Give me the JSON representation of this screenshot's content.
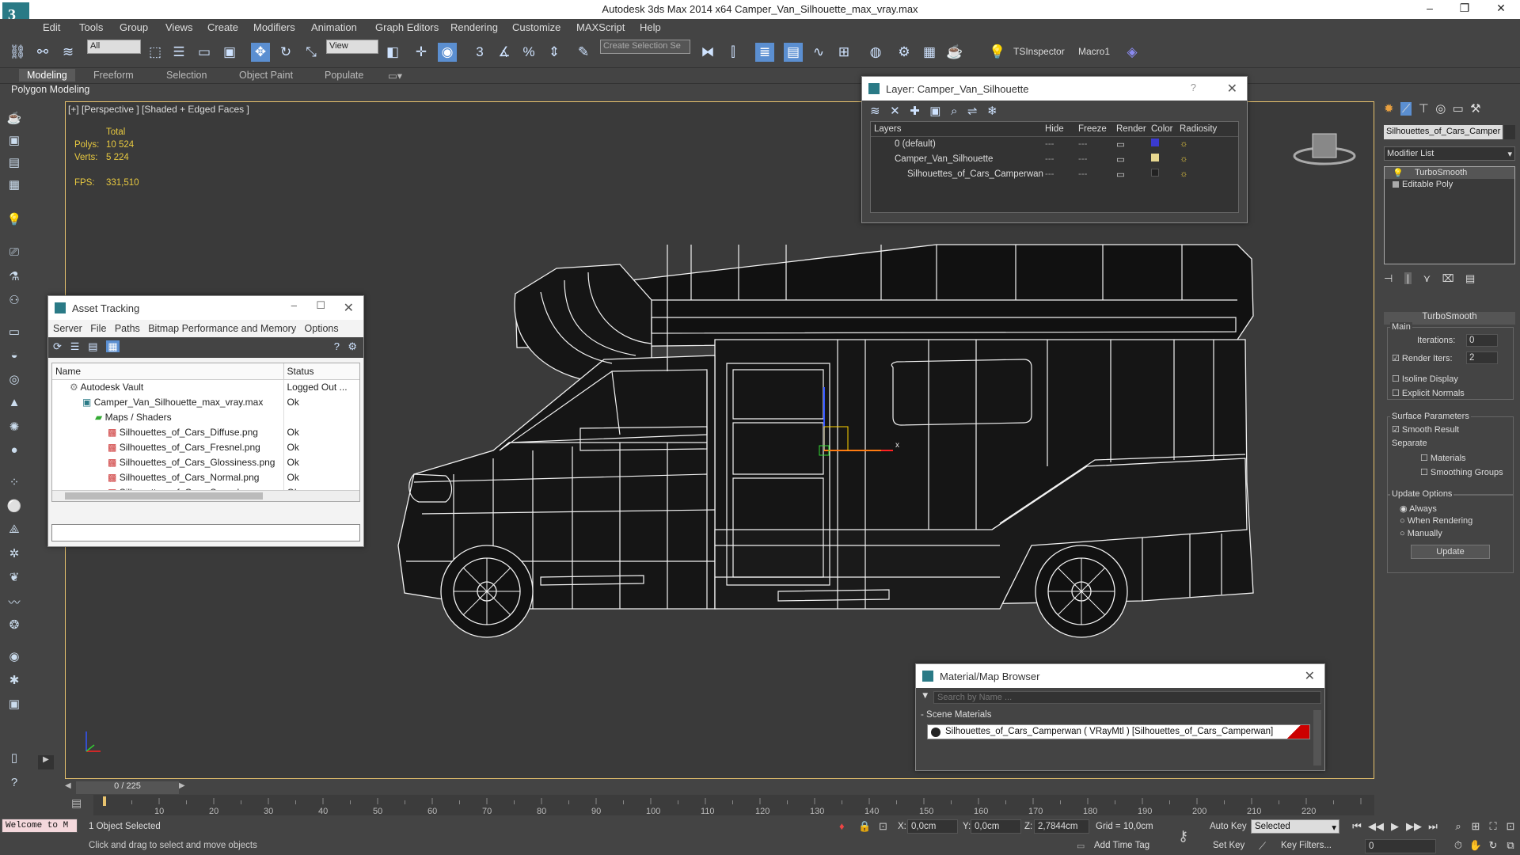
{
  "window": {
    "title": "Autodesk 3ds Max  2014 x64     Camper_Van_Silhouette_max_vray.max"
  },
  "menu": [
    "Edit",
    "Tools",
    "Group",
    "Views",
    "Create",
    "Modifiers",
    "Animation",
    "Graph Editors",
    "Rendering",
    "Customize",
    "MAXScript",
    "Help"
  ],
  "toolbar": {
    "filter": "All",
    "refcoord": "View",
    "selection_set": "Create Selection Se",
    "tsinspector": "TSInspector",
    "macro": "Macro1"
  },
  "ribbon": {
    "tabs": [
      "Modeling",
      "Freeform",
      "Selection",
      "Object Paint",
      "Populate"
    ],
    "sub": "Polygon Modeling"
  },
  "viewport": {
    "label": "[+] [Perspective ] [Shaded + Edged Faces ]",
    "stats": {
      "total": "Total",
      "polys_label": "Polys:",
      "polys": "10 524",
      "verts_label": "Verts:",
      "verts": "5 224",
      "fps_label": "FPS:",
      "fps": "331,510"
    },
    "gizmo_x": "x"
  },
  "layer_dialog": {
    "title": "Layer: Camper_Van_Silhouette",
    "help": "?",
    "columns": [
      "Layers",
      "Hide",
      "Freeze",
      "Render",
      "Color",
      "Radiosity"
    ],
    "rows": [
      {
        "name": "0 (default)",
        "color": "#3a3ad0"
      },
      {
        "name": "Camper_Van_Silhouette",
        "color": "#e8d890"
      },
      {
        "name": "Silhouettes_of_Cars_Camperwan",
        "color": "#222222"
      }
    ]
  },
  "asset_tracking": {
    "title": "Asset Tracking",
    "menu": [
      "Server",
      "File",
      "Paths",
      "Bitmap Performance and Memory",
      "Options"
    ],
    "columns": [
      "Name",
      "Status"
    ],
    "rows": [
      {
        "name": "Autodesk Vault",
        "status": "Logged Out ..."
      },
      {
        "name": "Camper_Van_Silhouette_max_vray.max",
        "status": "Ok"
      },
      {
        "name": "Maps / Shaders",
        "status": ""
      },
      {
        "name": "Silhouettes_of_Cars_Diffuse.png",
        "status": "Ok"
      },
      {
        "name": "Silhouettes_of_Cars_Fresnel.png",
        "status": "Ok"
      },
      {
        "name": "Silhouettes_of_Cars_Glossiness.png",
        "status": "Ok"
      },
      {
        "name": "Silhouettes_of_Cars_Normal.png",
        "status": "Ok"
      },
      {
        "name": "Silhouettes_of_Cars_Specular.png",
        "status": "Ok"
      }
    ]
  },
  "material_browser": {
    "title": "Material/Map Browser",
    "search_placeholder": "Search by Name ...",
    "section": "- Scene Materials",
    "item": "Silhouettes_of_Cars_Camperwan ( VRayMtl ) [Silhouettes_of_Cars_Camperwan]"
  },
  "command_panel": {
    "object_name": "Silhouettes_of_Cars_Camper",
    "modifier_list": "Modifier List",
    "stack": [
      "TurboSmooth",
      "Editable Poly"
    ],
    "rollout": "TurboSmooth",
    "main": "Main",
    "iterations_label": "Iterations:",
    "iterations": "0",
    "render_iters_label": "Render Iters:",
    "render_iters": "2",
    "isoline": "Isoline Display",
    "explicit": "Explicit Normals",
    "surface": "Surface Parameters",
    "smooth": "Smooth Result",
    "separate": "Separate",
    "materials": "Materials",
    "smoothing": "Smoothing Groups",
    "update_options": "Update Options",
    "always": "Always",
    "when_rendering": "When Rendering",
    "manually": "Manually",
    "update": "Update"
  },
  "timeline": {
    "frame": "0 / 225",
    "ticks": [
      "10",
      "20",
      "30",
      "40",
      "50",
      "60",
      "70",
      "80",
      "90",
      "100",
      "110",
      "120",
      "130",
      "140",
      "150",
      "160",
      "170",
      "180",
      "190",
      "200",
      "210",
      "220"
    ]
  },
  "status": {
    "welcome": "Welcome to M",
    "selected": "1 Object Selected",
    "prompt": "Click and drag to select and move objects",
    "x_label": "X:",
    "x": "0,0cm",
    "y_label": "Y:",
    "y": "0,0cm",
    "z_label": "Z:",
    "z": "2,7844cm",
    "grid": "Grid = 10,0cm",
    "add_time_tag": "Add Time Tag",
    "auto_key": "Auto Key",
    "set_key": "Set Key",
    "key_mode": "Selected",
    "key_filters": "Key Filters...",
    "frame_field": "0"
  }
}
